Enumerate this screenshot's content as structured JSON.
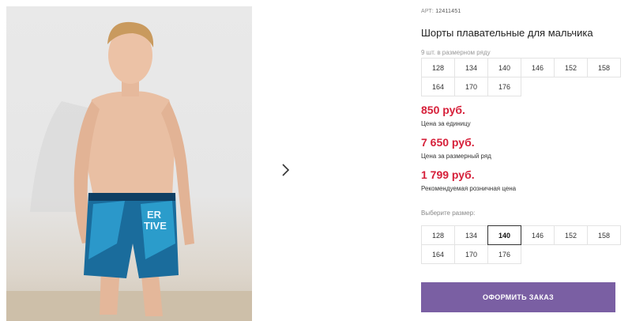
{
  "product": {
    "sku_label": "АРТ:",
    "sku_value": "12411451",
    "title": "Шорты плавательные для мальчика",
    "range_note": "9 шт. в размерном ряду",
    "range_sizes": [
      "128",
      "134",
      "140",
      "146",
      "152",
      "158",
      "164",
      "170",
      "176"
    ],
    "image": {
      "alt": "product-photo",
      "shorts_text": [
        "ER",
        "TIVE"
      ]
    }
  },
  "prices": [
    {
      "amount": "850 руб.",
      "label": "Цена за единицу"
    },
    {
      "amount": "7 650 руб.",
      "label": "Цена за размерный ряд"
    },
    {
      "amount": "1 799 руб.",
      "label": "Рекомендуемая розничная цена"
    }
  ],
  "size_select": {
    "label": "Выберите размер:",
    "options": [
      "128",
      "134",
      "140",
      "146",
      "152",
      "158",
      "164",
      "170",
      "176"
    ],
    "selected": "140"
  },
  "actions": {
    "order_button": "ОФОРМИТЬ ЗАКАЗ",
    "next_icon": "chevron-right-icon"
  },
  "colors": {
    "price": "#d6203a",
    "button": "#7a5fa3",
    "border": "#e3e3e3"
  }
}
